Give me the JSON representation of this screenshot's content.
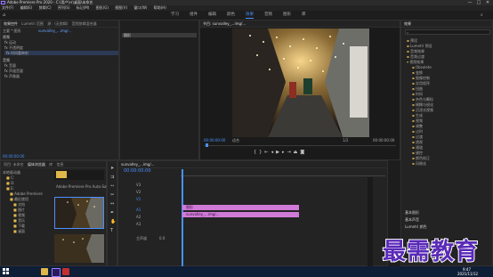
{
  "window": {
    "title": "Adobe Premiere Pro 2020 - C:\\用户\\Ｈ\\桌面\\未命名",
    "controls": {
      "minimize": "—",
      "maximize": "□",
      "close": "✕"
    }
  },
  "menu": [
    "文件(F)",
    "编辑(E)",
    "剪辑(C)",
    "序列(S)",
    "标记(M)",
    "图形(G)",
    "视图(V)",
    "窗口(W)",
    "帮助(H)"
  ],
  "workspaces": [
    "学习",
    "组件",
    "编辑",
    "颜色",
    "效果",
    "音频",
    "图形",
    "库"
  ],
  "active_workspace": "效果",
  "effect_controls": {
    "tabs": [
      "效果控件",
      "Lumetri 范围",
      "源：(无剪辑)",
      "音频剪辑混合器"
    ],
    "clip_path": "主要 * 图形",
    "clip_name": "sunvalley_...img/...",
    "sections": [
      "视频",
      "运动",
      "不透明度",
      "时间重映射",
      "音频",
      "音量",
      "声道音量",
      "声像器"
    ],
    "graphic_label": "图形",
    "timecode": "00:00:00:00"
  },
  "program_monitor": {
    "tab": "节目: sunvalley_...img/...",
    "timecode_in": "00:00:00:00",
    "fit_label": "适合",
    "quality_label": "1/2",
    "timecode_out": "00:00:00:00"
  },
  "project": {
    "tabs": [
      "项目: 未命名",
      "媒体浏览器",
      "库",
      "信息"
    ],
    "folders": [
      "本地驱动器",
      "C:",
      "D:",
      "E:",
      "Adobe Premiere",
      "最近使用",
      "文档",
      "图片",
      "视频",
      "音乐",
      "下载",
      "桌面"
    ],
    "clip_label": "Adobe Premiere Pro Auto-Save"
  },
  "timeline": {
    "tab": "sunvalley_...img/...",
    "timecode": "00:00:00:00",
    "tracks_video": [
      "V3",
      "V2",
      "V1"
    ],
    "tracks_audio": [
      "A1",
      "A2",
      "A3"
    ],
    "master_label": "主声道",
    "master_value": "0.0",
    "clip_v1_label": "图形",
    "clip_a1_label": "sunvalley_...img/..."
  },
  "effects_panel": {
    "tab": "效果",
    "tree": [
      "预设",
      "Lumetri 预设",
      "音频效果",
      "音频过渡",
      "视频效果",
      "Obsolete",
      "变换",
      "图像控制",
      "实用程序",
      "扭曲",
      "时间",
      "杂色与颗粒",
      "模糊与锐化",
      "沉浸式视频",
      "生成",
      "视频",
      "调整",
      "过时",
      "过渡",
      "透视",
      "通道",
      "键控",
      "颜色校正",
      "风格化"
    ],
    "search_placeholder": "",
    "footer": [
      "基本图形",
      "基本声音",
      "Lumetri 颜色"
    ]
  },
  "taskbar": {
    "time": "9:47",
    "date": "2021/11/12"
  },
  "watermark": "最需教育",
  "colors": {
    "accent": "#4a90ff",
    "audio_clip": "#d07ad8",
    "video_clip": "#d07ad8"
  }
}
